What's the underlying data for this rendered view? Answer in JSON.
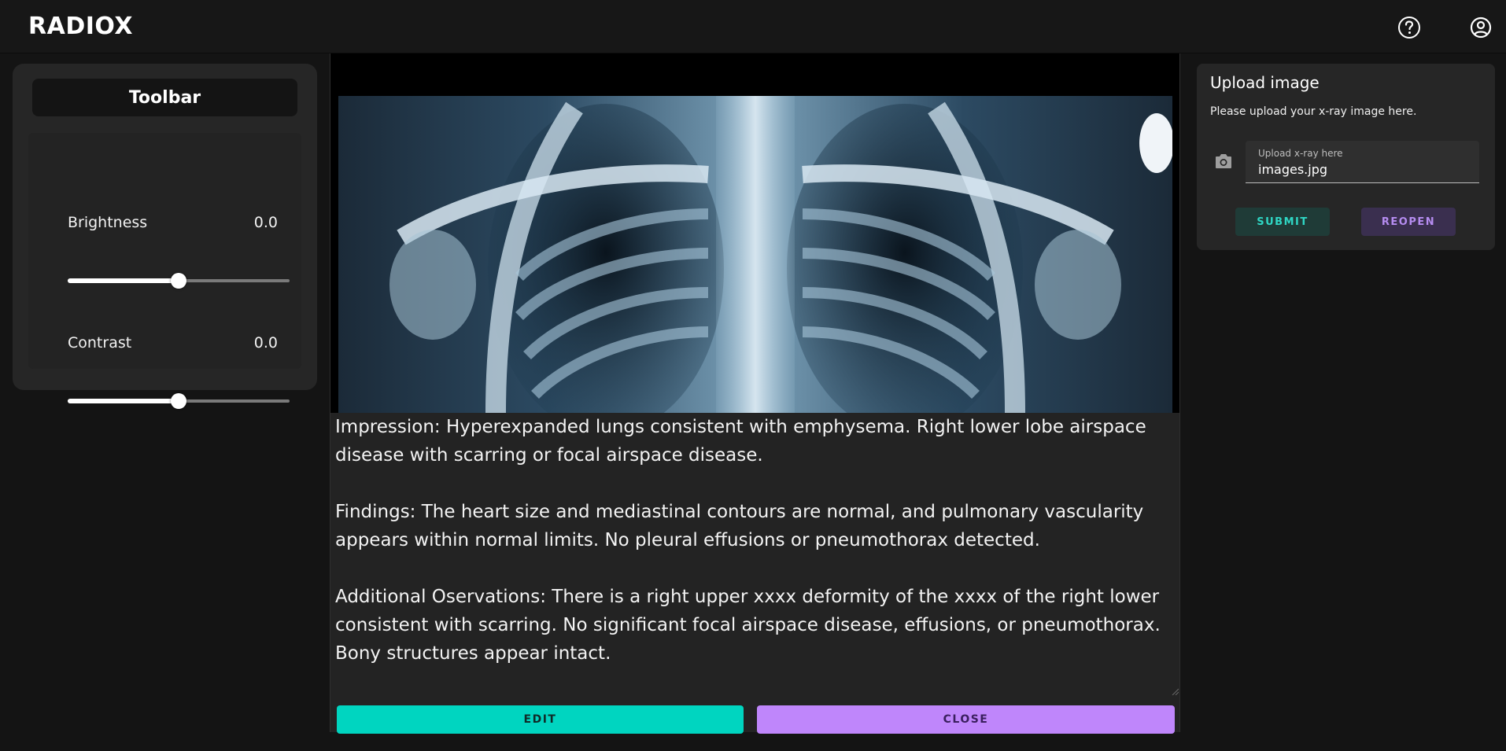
{
  "app": {
    "title": "RADIOX"
  },
  "header": {
    "help_icon": "help-circle-icon",
    "account_icon": "account-circle-icon"
  },
  "toolbar": {
    "title": "Toolbar",
    "brightness": {
      "label": "Brightness",
      "value": "0.0",
      "level": 0.5
    },
    "contrast": {
      "label": "Contrast",
      "value": "0.0",
      "level": 0.5
    }
  },
  "report": {
    "text": "Impression: Hyperexpanded lungs consistent with emphysema. Right lower lobe airspace disease with scarring or focal airspace disease.\n\nFindings: The heart size and mediastinal contours are normal, and pulmonary vascularity appears within normal limits. No pleural effusions or pneumothorax detected.\n\nAdditional Oservations: There is a right upper xxxx deformity of the xxxx of the right lower consistent with scarring. No significant focal airspace disease, effusions, or pneumothorax. Bony structures appear intact."
  },
  "actions": {
    "edit_label": "EDIT",
    "close_label": "CLOSE"
  },
  "upload": {
    "title": "Upload image",
    "subtitle": "Please upload your x-ray image here.",
    "field_label": "Upload x-ray here",
    "field_value": "images.jpg",
    "camera_icon": "camera-icon",
    "submit_label": "SUBMIT",
    "reopen_label": "REOPEN"
  },
  "colors": {
    "accent_teal": "#00d5c0",
    "accent_purple": "#bf86fb",
    "background": "#141414",
    "panel": "#262626"
  }
}
